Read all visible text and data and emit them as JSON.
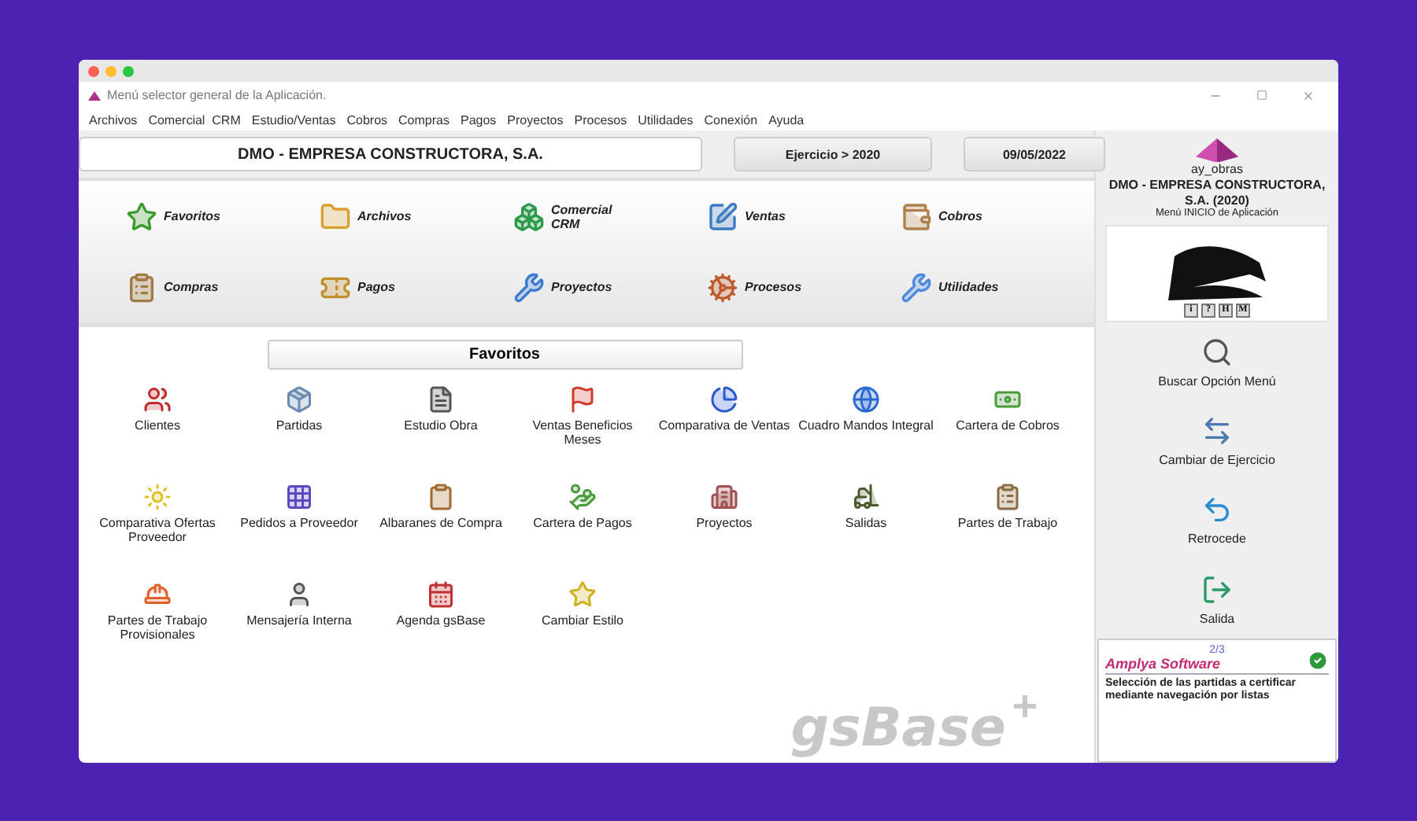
{
  "window": {
    "title": "Menú selector general de la Aplicación."
  },
  "menu": [
    "Archivos",
    "Comercial  CRM",
    "Estudio/Ventas",
    "Cobros",
    "Compras",
    "Pagos",
    "Proyectos",
    "Procesos",
    "Utilidades",
    "Conexión",
    "Ayuda"
  ],
  "header": {
    "company": "DMO - EMPRESA CONSTRUCTORA, S.A.",
    "exercise": "Ejercicio > 2020",
    "date": "09/05/2022"
  },
  "modules": [
    {
      "label": "Favoritos"
    },
    {
      "label": "Archivos"
    },
    {
      "label": "Comercial CRM"
    },
    {
      "label": "Ventas"
    },
    {
      "label": "Cobros"
    },
    {
      "label": "Compras"
    },
    {
      "label": "Pagos"
    },
    {
      "label": "Proyectos"
    },
    {
      "label": "Procesos"
    },
    {
      "label": "Utilidades"
    }
  ],
  "favorites": {
    "title": "Favoritos",
    "items": [
      {
        "label": "Clientes"
      },
      {
        "label": "Partidas"
      },
      {
        "label": "Estudio Obra"
      },
      {
        "label": "Ventas Beneficios Meses"
      },
      {
        "label": "Comparativa de Ventas"
      },
      {
        "label": "Cuadro Mandos Integral"
      },
      {
        "label": "Cartera de Cobros"
      },
      {
        "label": "Comparativa Ofertas Proveedor"
      },
      {
        "label": "Pedidos a Proveedor"
      },
      {
        "label": "Albaranes de Compra"
      },
      {
        "label": "Cartera de Pagos"
      },
      {
        "label": "Proyectos"
      },
      {
        "label": "Salidas"
      },
      {
        "label": "Partes de Trabajo"
      },
      {
        "label": "Partes de Trabajo Provisionales"
      },
      {
        "label": "Mensajería Interna"
      },
      {
        "label": "Agenda gsBase"
      },
      {
        "label": "Cambiar Estilo"
      }
    ]
  },
  "brand": "gsBase",
  "sidebar": {
    "user": "ay_obras",
    "company": "DMO - EMPRESA CONSTRUCTORA, S.A. (2020)",
    "subtitle": "Menú INICIO de Aplicación",
    "logo_buttons": [
      "i",
      "?",
      "H",
      "M"
    ],
    "actions": [
      {
        "label": "Buscar Opción Menú"
      },
      {
        "label": "Cambiar de Ejercicio"
      },
      {
        "label": "Retrocede"
      },
      {
        "label": "Salida"
      }
    ],
    "tip": {
      "page": "2/3",
      "title": "Amplya Software",
      "text": "Selección de las partidas a certificar mediante navegación por listas"
    }
  }
}
